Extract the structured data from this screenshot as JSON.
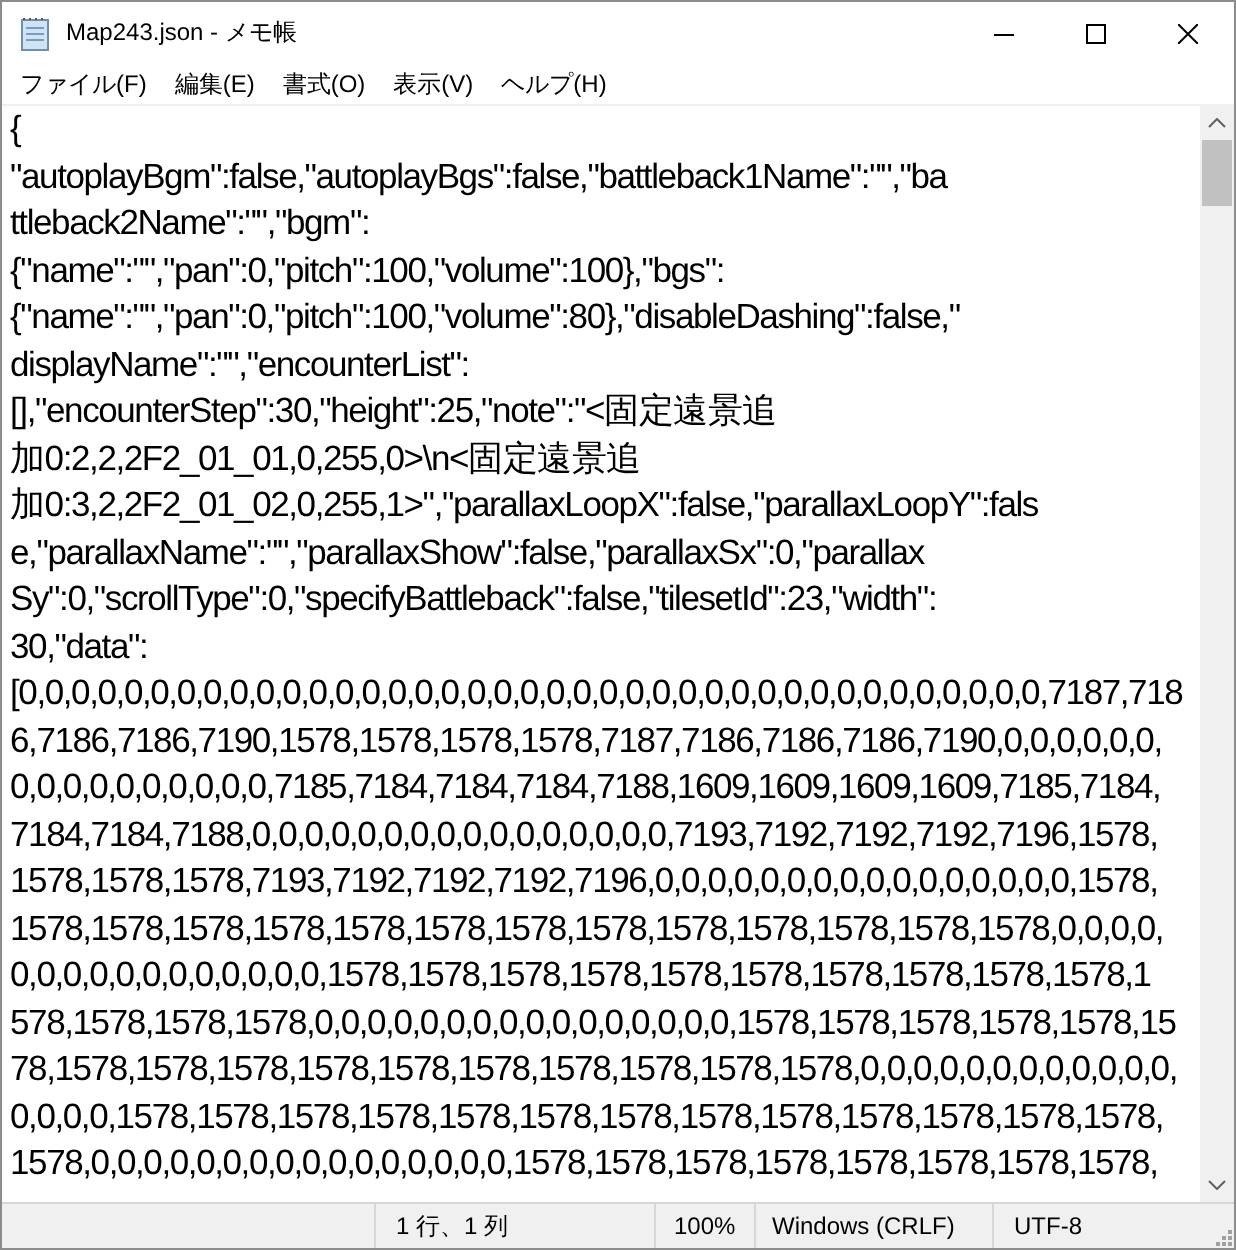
{
  "window": {
    "title": "Map243.json - メモ帳"
  },
  "menu": [
    "ファイル(F)",
    "編集(E)",
    "書式(O)",
    "表示(V)",
    "ヘルプ(H)"
  ],
  "editor": {
    "lines": [
      "{",
      "\"autoplayBgm\":false,\"autoplayBgs\":false,\"battleback1Name\":\"\",\"ba",
      "ttleback2Name\":\"\",\"bgm\":",
      "{\"name\":\"\",\"pan\":0,\"pitch\":100,\"volume\":100},\"bgs\":",
      "{\"name\":\"\",\"pan\":0,\"pitch\":100,\"volume\":80},\"disableDashing\":false,\"",
      "displayName\":\"\",\"encounterList\":",
      "[],\"encounterStep\":30,\"height\":25,\"note\":\"<固定遠景追",
      "加0:2,2,2F2_01_01,0,255,0>\\n<固定遠景追",
      "加0:3,2,2F2_01_02,0,255,1>\",\"parallaxLoopX\":false,\"parallaxLoopY\":fals",
      "e,\"parallaxName\":\"\",\"parallaxShow\":false,\"parallaxSx\":0,\"parallax",
      "Sy\":0,\"scrollType\":0,\"specifyBattleback\":false,\"tilesetId\":23,\"width\":",
      "30,\"data\":",
      "[0,0,0,0,0,0,0,0,0,0,0,0,0,0,0,0,0,0,0,0,0,0,0,0,0,0,0,0,0,0,0,0,0,0,0,0,0,0,0,7187,718",
      "6,7186,7186,7190,1578,1578,1578,1578,7187,7186,7186,7186,7190,0,0,0,0,0,0,",
      "0,0,0,0,0,0,0,0,0,0,7185,7184,7184,7184,7188,1609,1609,1609,1609,7185,7184,",
      "7184,7184,7188,0,0,0,0,0,0,0,0,0,0,0,0,0,0,0,0,7193,7192,7192,7192,7196,1578,",
      "1578,1578,1578,7193,7192,7192,7192,7196,0,0,0,0,0,0,0,0,0,0,0,0,0,0,0,0,1578,",
      "1578,1578,1578,1578,1578,1578,1578,1578,1578,1578,1578,1578,1578,0,0,0,0,",
      "0,0,0,0,0,0,0,0,0,0,0,0,1578,1578,1578,1578,1578,1578,1578,1578,1578,1578,1",
      "578,1578,1578,1578,0,0,0,0,0,0,0,0,0,0,0,0,0,0,0,0,1578,1578,1578,1578,1578,15",
      "78,1578,1578,1578,1578,1578,1578,1578,1578,1578,1578,0,0,0,0,0,0,0,0,0,0,0,0,",
      "0,0,0,0,1578,1578,1578,1578,1578,1578,1578,1578,1578,1578,1578,1578,1578,",
      "1578,0,0,0,0,0,0,0,0,0,0,0,0,0,0,0,0,1578,1578,1578,1578,1578,1578,1578,1578,"
    ]
  },
  "status_bar": [
    "1 行、1 列",
    "100%",
    "Windows (CRLF)",
    "UTF-8"
  ]
}
